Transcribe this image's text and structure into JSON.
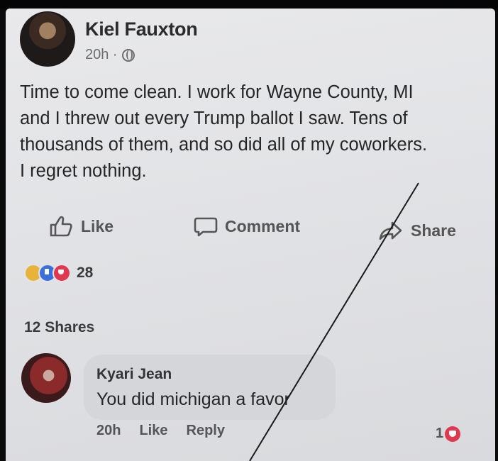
{
  "post": {
    "author": "Kiel Fauxton",
    "time": "20h ·",
    "privacy_icon": "globe-icon",
    "text": "Time to come clean. I work for Wayne County, MI\nand I threw out every Trump ballot I saw. Tens of\nthousands of them, and so did all of my coworkers.\nI regret nothing."
  },
  "actions": {
    "like": "Like",
    "comment": "Comment",
    "share": "Share"
  },
  "reactions": {
    "types": [
      "haha",
      "like",
      "love"
    ],
    "count": "28"
  },
  "shares": "12 Shares",
  "comment": {
    "author": "Kyari Jean",
    "text": "You did michigan a favor",
    "time": "20h",
    "like": "Like",
    "reply": "Reply",
    "reaction_count": "1"
  },
  "colors": {
    "background": "#0a0a0a",
    "screen": "#e3e4e7",
    "text": "#262626",
    "love": "#e0384f",
    "like": "#3b6fd9",
    "haha": "#e8b33a"
  }
}
